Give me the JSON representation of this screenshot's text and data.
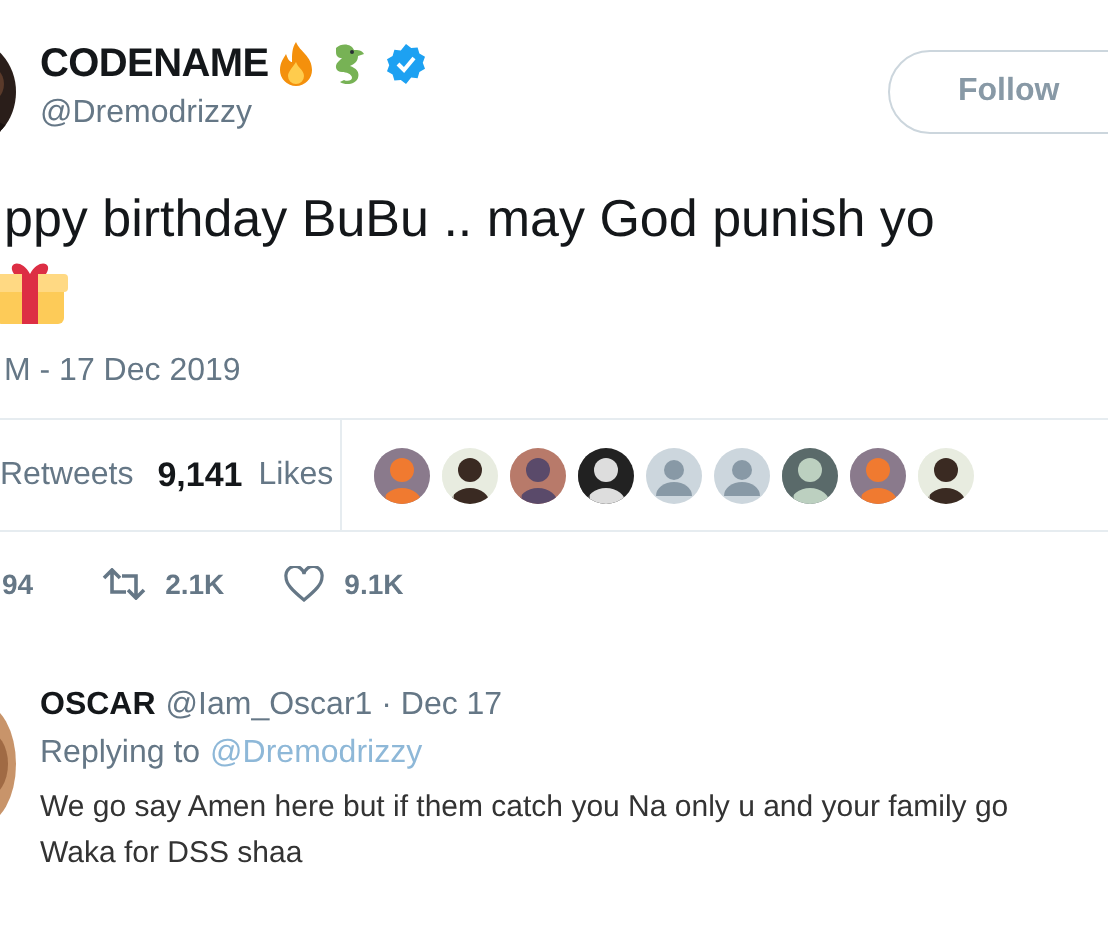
{
  "author": {
    "name": "CODENAME",
    "handle": "@Dremodrizzy",
    "verified": true
  },
  "follow_button": {
    "label": "Follow"
  },
  "tweet": {
    "text": "ppy birthday BuBu .. may God punish yo",
    "timestamp": "M - 17 Dec 2019"
  },
  "stats": {
    "retweets_label": "Retweets",
    "likes_count": "9,141",
    "likes_label": "Likes"
  },
  "likers": [
    {
      "kind": "picture"
    },
    {
      "kind": "picture"
    },
    {
      "kind": "picture"
    },
    {
      "kind": "picture"
    },
    {
      "kind": "default"
    },
    {
      "kind": "default"
    },
    {
      "kind": "picture"
    },
    {
      "kind": "picture"
    },
    {
      "kind": "picture"
    }
  ],
  "actions": [
    {
      "kind": "reply",
      "count": "94"
    },
    {
      "kind": "retweet",
      "count": "2.1K"
    },
    {
      "kind": "like",
      "count": "9.1K"
    }
  ],
  "reply": {
    "name": "OSCAR",
    "handle": "@Iam_Oscar1 · Dec 17",
    "replying_label": "Replying to",
    "replying_handle": "@Dremodrizzy",
    "text": "We go say Amen here but if them catch you Na only u and your family go\nWaka for DSS shaa"
  }
}
